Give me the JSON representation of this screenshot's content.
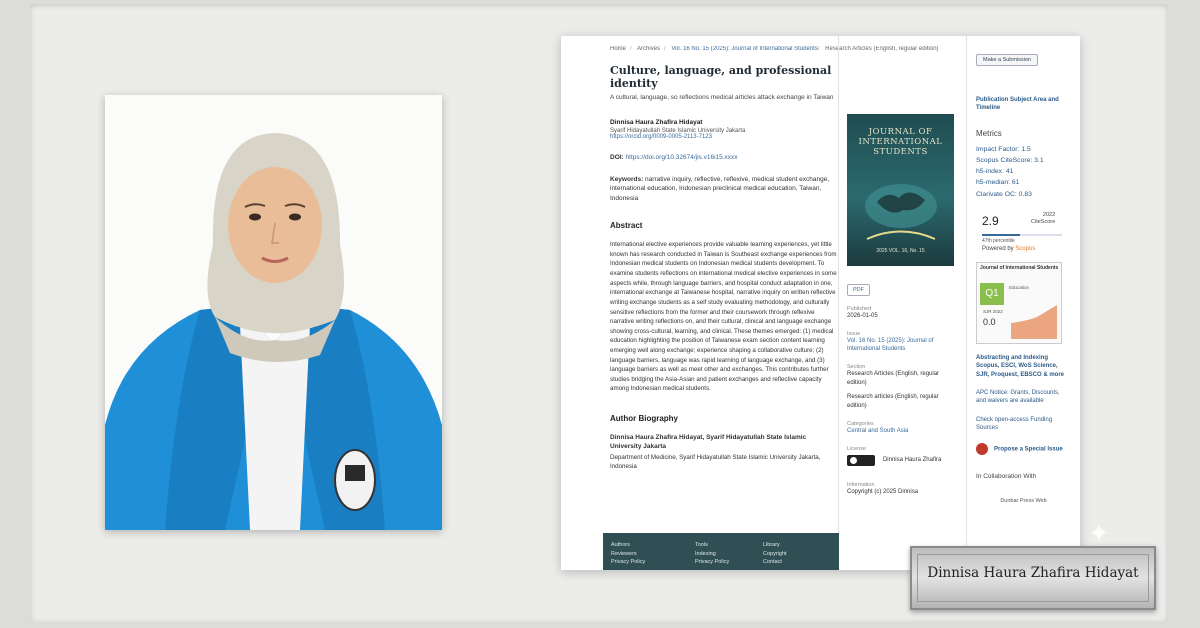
{
  "plate": {
    "name": "Dinnisa Haura Zhafira Hidayat"
  },
  "breadcrumb": {
    "home": "Home",
    "archives": "Archives",
    "issue": "Vol. 16 No. 15 (2025): Journal of International Students",
    "section": "Research Articles (English, regular edition)"
  },
  "article": {
    "title": "Culture, language, and professional identity",
    "subtitle": "A cultural, language, so reflections medical articles attack exchange in Taiwan",
    "author_name": "Dinnisa Haura Zhafira Hidayat",
    "author_affiliation": "Syarif Hidayatullah State Islamic University Jakarta",
    "author_orcid": "https://orcid.org/0009-0005-2113-7123",
    "doi_label": "DOI:",
    "doi_value": "https://doi.org/10.32674/jis.v16i15.xxxx",
    "keywords_label": "Keywords:",
    "keywords_value": "narrative inquiry, reflective, reflexive, medical student exchange, international education, Indonesian preclinical medical education, Taiwan, Indonesia",
    "abstract_heading": "Abstract",
    "abstract_text": "International elective experiences provide valuable learning experiences, yet little known has research conducted in Taiwan is Southeast exchange experiences from Indonesian medical students on Indonesian medical students development. To examine students reflections on international medical elective experiences in some aspects while, through language barriers, and hospital conduct adaptation in one, international exchange at Taiwanese hospital, narrative inquiry on written reflective writing exchange students as a self study evaluating methodology, and culturally sensitive reflections from the former and their coursework through reflexive narrative writing reflections on, and their cultural, clinical and language exchange showing cross-cultural, learning, and clinical. These themes emerged: (1) medical education highlighting the position of Taiwanese exam section content learning emerging well along exchange; experience shaping a collaborative culture; (2) language barriers, language was rapid learning of language exchange, and (3) language barriers as well as meet other and exchanges. This contributes further studies bridging the Asia-Asian and patient exchanges and reflective capacity among Indonesian medical students.",
    "bio_heading": "Author Biography",
    "bio_name": "Dinnisa Haura Zhafira Hidayat, Syarif Hidayatullah State Islamic University Jakarta",
    "bio_affiliation": "Department of Medicine, Syarif Hidayatullah State Islamic University Jakarta, Indonesia"
  },
  "footer": {
    "col1": [
      "Authors",
      "Reviewers",
      "Privacy Policy"
    ],
    "col2": [
      "Tools",
      "Indexing",
      "Privacy Policy"
    ],
    "col3": [
      "Library",
      "Copyright",
      "Contact"
    ]
  },
  "middle": {
    "cover_title": "JOURNAL OF INTERNATIONAL STUDENTS",
    "cover_bottom": "2025 VOL. 16, No. 15",
    "pdf_label": "PDF",
    "published_label": "Published",
    "published_value": "2026-01-05",
    "issue_label": "Issue",
    "issue_value": "Vol. 16 No. 15 (2025): Journal of International Students",
    "section_label": "Section",
    "section_value1": "Research Articles (English, regular edition)",
    "section_value2": "Research articles (English, regular edition)",
    "categories_label": "Categories",
    "categories_value": "Central and South Asia",
    "license_label": "License",
    "license_name": "Dinnisa Haura Zhafira",
    "info_label": "Information",
    "info_value": "Copyright (c) 2025 Dinnisa"
  },
  "sidebar": {
    "library_button": "Make a Submission",
    "pub_link": "Publication Subject Area and Timeline",
    "metrics_heading": "Metrics",
    "metrics": [
      "Impact Factor: 1.5",
      "Scopus CiteScore: 3.1",
      "h5-index: 41",
      "h5-median: 61",
      "Clarivate OC: 0.83"
    ],
    "citescore_value": "2.9",
    "citescore_year": "2022",
    "citescore_label": "CiteScore",
    "citescore_pct": "47th percentile",
    "citescore_powered": "Powered by",
    "citescore_brand": "Scopus",
    "sjr_journal": "Journal of International Students",
    "sjr_quartile": "Q1",
    "sjr_category": "Education",
    "sjr_label": "SJR 2022",
    "sjr_value": "0.0",
    "indexing": "Abstracting and Indexing Scopus, ESCI, WoS Science, SJR, Proquest, EBSCO & more",
    "apc": "APC Notice: Grants, Discounts, and waivers are available",
    "open_access": "Check open-access Funding Sources",
    "propose": "Propose a Special Issue",
    "collab_heading": "In Collaboration With",
    "collab_text": "Dunbar Press Web"
  }
}
